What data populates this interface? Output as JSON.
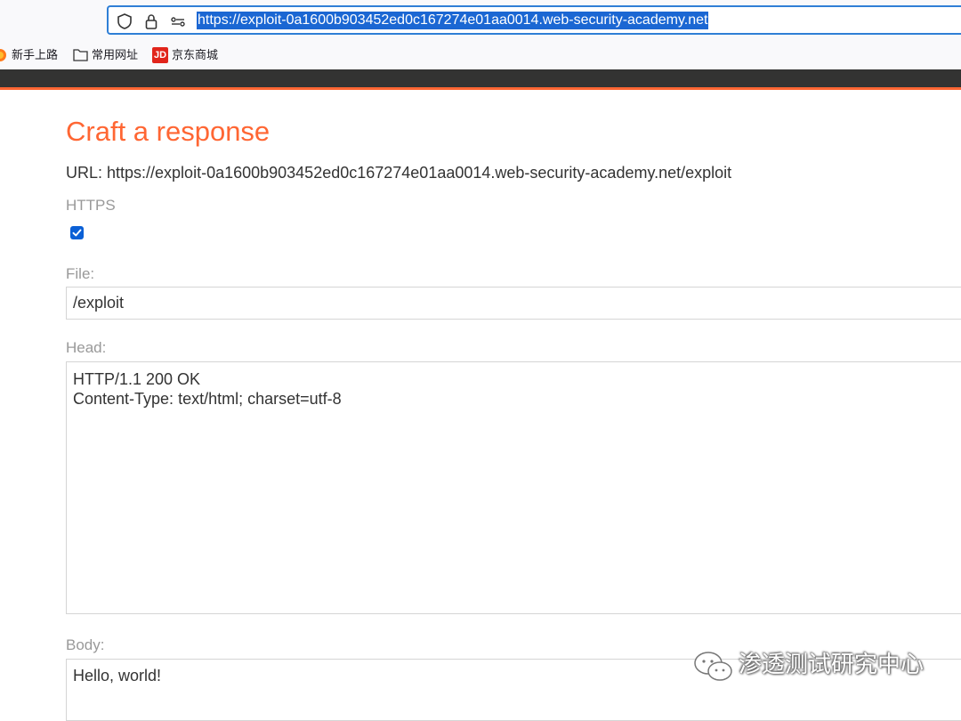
{
  "browser": {
    "address": "https://exploit-0a1600b903452ed0c167274e01aa0014.web-security-academy.net",
    "bookmarks": [
      {
        "label": "新手上路",
        "icon": "firefox-icon"
      },
      {
        "label": "常用网址",
        "icon": "folder-icon"
      },
      {
        "label": "京东商城",
        "icon": "jd-icon",
        "icon_text": "JD"
      }
    ]
  },
  "page": {
    "title": "Craft a response",
    "url_line": "URL: https://exploit-0a1600b903452ed0c167274e01aa0014.web-security-academy.net/exploit",
    "https_label": "HTTPS",
    "https_checked": true,
    "file_label": "File:",
    "file_value": "/exploit",
    "head_label": "Head:",
    "head_lines": [
      "HTTP/1.1 200 OK",
      "Content-Type: text/html; charset=utf-8"
    ],
    "body_label": "Body:",
    "body_value": "Hello, world!"
  },
  "watermark": {
    "text": "渗透测试研究中心"
  },
  "colors": {
    "accent": "#ff6633",
    "header_bg": "#333332",
    "selection": "#1b67d3",
    "checkbox": "#0b60d6"
  }
}
